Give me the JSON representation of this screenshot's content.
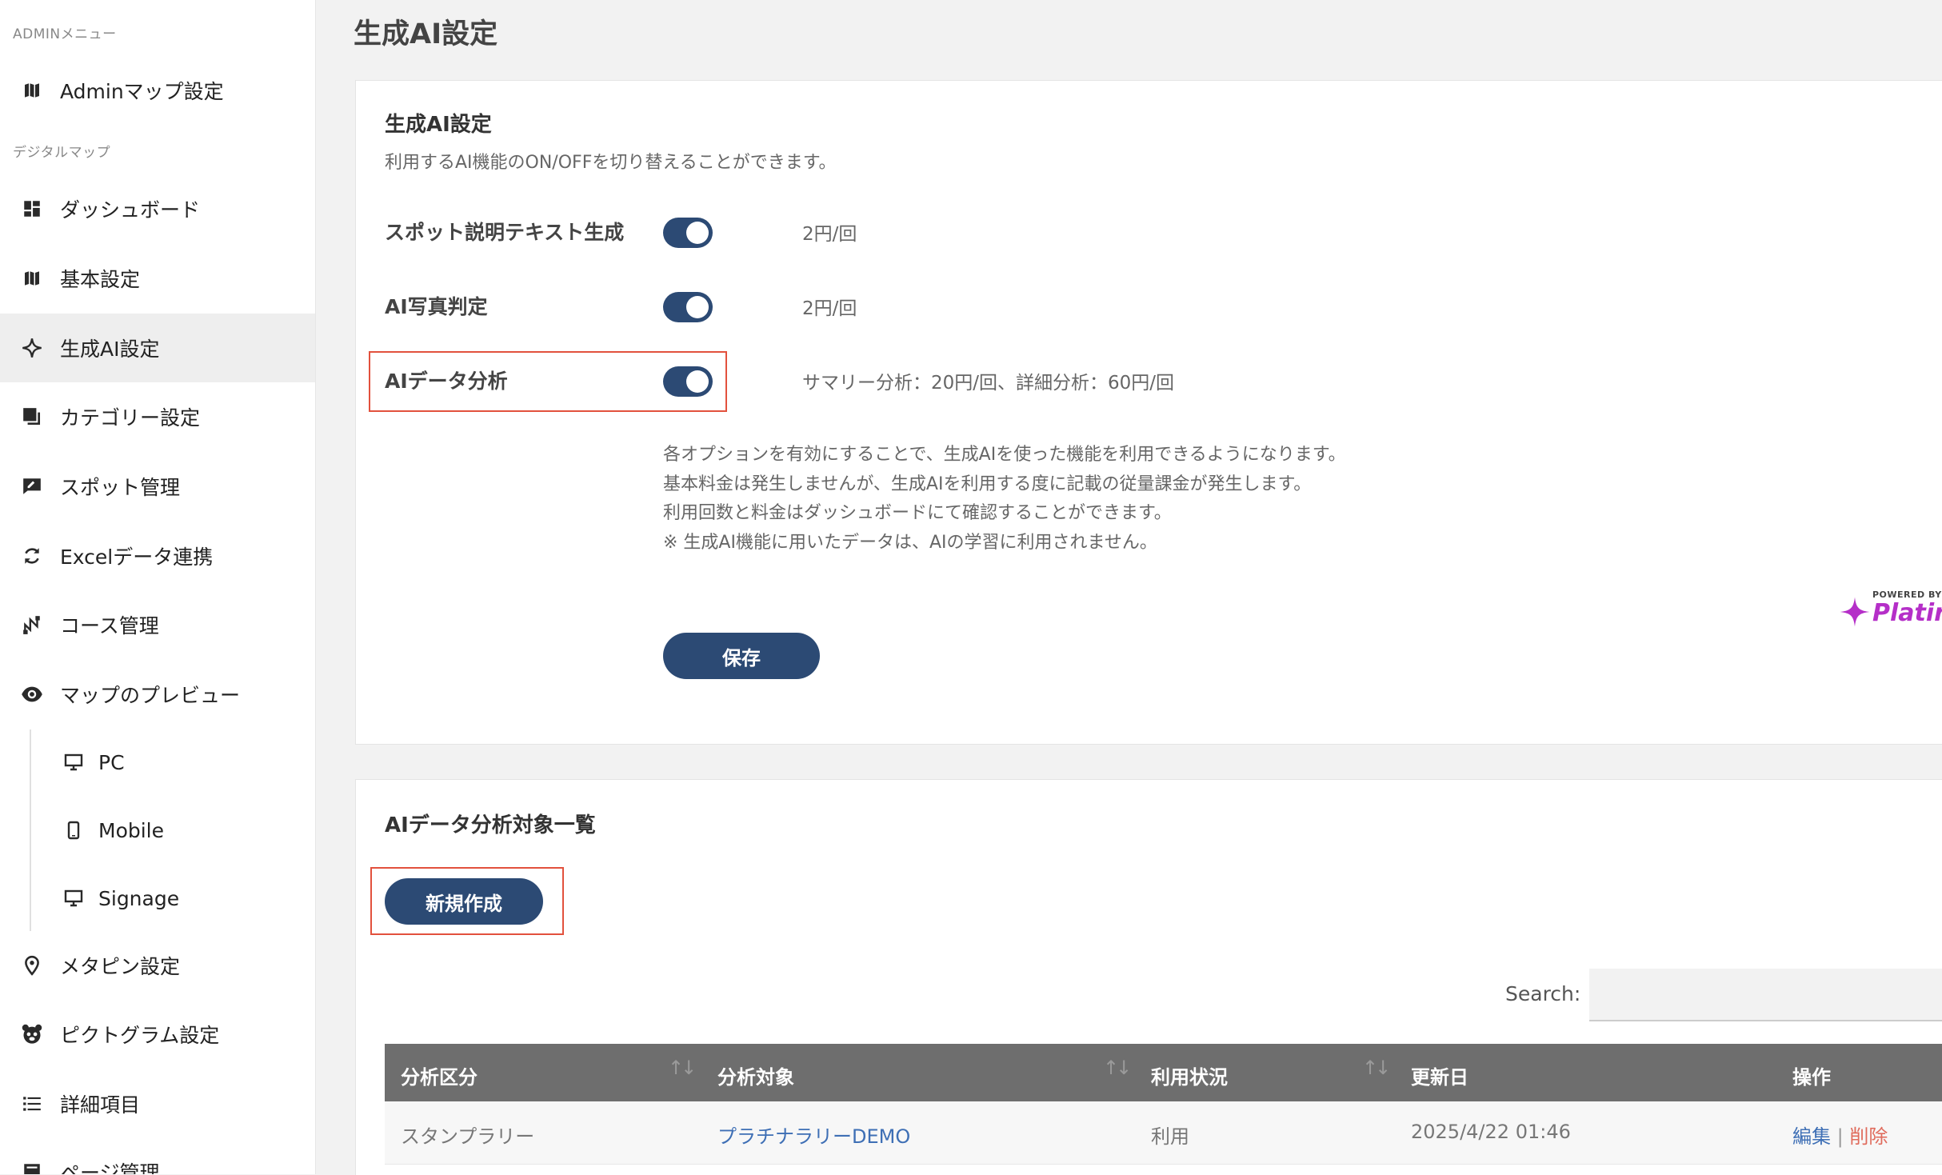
{
  "sidebar": {
    "section_admin": "ADMINメニュー",
    "section_digital": "デジタルマップ",
    "items": [
      {
        "label": "Adminマップ設定",
        "icon": "map-icon"
      },
      {
        "label": "ダッシュボード",
        "icon": "dashboard-icon"
      },
      {
        "label": "基本設定",
        "icon": "map-icon"
      },
      {
        "label": "生成AI設定",
        "icon": "sparkle-icon",
        "active": true
      },
      {
        "label": "カテゴリー設定",
        "icon": "layers-icon"
      },
      {
        "label": "スポット管理",
        "icon": "chat-edit-icon"
      },
      {
        "label": "Excelデータ連携",
        "icon": "sync-icon"
      },
      {
        "label": "コース管理",
        "icon": "route-icon"
      },
      {
        "label": "マップのプレビュー",
        "icon": "eye-icon"
      },
      {
        "label": "PC",
        "icon": "desktop-icon"
      },
      {
        "label": "Mobile",
        "icon": "mobile-icon"
      },
      {
        "label": "Signage",
        "icon": "monitor-icon"
      },
      {
        "label": "メタピン設定",
        "icon": "pin-icon"
      },
      {
        "label": "ピクトグラム設定",
        "icon": "panda-icon"
      },
      {
        "label": "詳細項目",
        "icon": "list-icon"
      },
      {
        "label": "ページ管理",
        "icon": "page-icon"
      }
    ]
  },
  "page_title": "生成AI設定",
  "settings_card": {
    "title": "生成AI設定",
    "description": "利用するAI機能のON/OFFを切り替えることができます。",
    "options": [
      {
        "label": "スポット説明テキスト生成",
        "enabled": true,
        "price": "2円/回"
      },
      {
        "label": "AI写真判定",
        "enabled": true,
        "price": "2円/回"
      },
      {
        "label": "AIデータ分析",
        "enabled": true,
        "price": "サマリー分析：20円/回、詳細分析：60円/回"
      }
    ],
    "notes": [
      "各オプションを有効にすることで、生成AIを使った機能を利用できるようになります。",
      "基本料金は発生しませんが、生成AIを利用する度に記載の従量課金が発生します。",
      "利用回数と料金はダッシュボードにて確認することができます。",
      "※ 生成AI機能に用いたデータは、AIの学習に利用されません。"
    ],
    "save_label": "保存",
    "powered_by": "POWERED BY",
    "powered_brand": "Platir"
  },
  "list_card": {
    "title": "AIデータ分析対象一覧",
    "new_label": "新規作成",
    "search_label": "Search:",
    "search_value": "",
    "columns": [
      "分析区分",
      "分析対象",
      "利用状況",
      "更新日",
      "操作"
    ],
    "rows": [
      {
        "category": "スタンプラリー",
        "target": "プラチナラリーDEMO",
        "status": "利用",
        "updated": "2025/4/22 01:46",
        "edit": "編集",
        "separator": "|",
        "delete": "削除"
      }
    ]
  },
  "colors": {
    "accent": "#2c4a74",
    "highlight_box": "#e2513d",
    "header_bg": "#6e6e6e",
    "link": "#3e6fb5",
    "danger": "#e06b5c",
    "brand": "#b52fc8"
  }
}
